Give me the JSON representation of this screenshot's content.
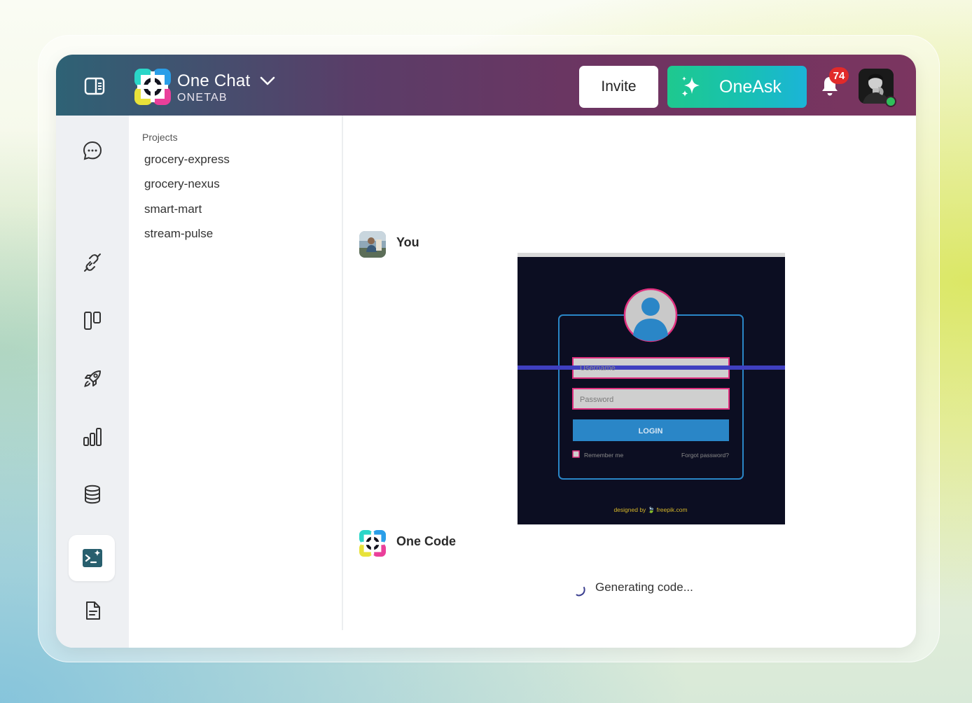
{
  "header": {
    "app_title": "One Chat",
    "app_subtitle": "ONETAB",
    "invite_label": "Invite",
    "oneask_label": "OneAsk",
    "notification_count": "74"
  },
  "projects": {
    "label": "Projects",
    "items": [
      "grocery-express",
      "grocery-nexus",
      "smart-mart",
      "stream-pulse"
    ]
  },
  "chat": {
    "user_name": "You",
    "bot_name": "One Code",
    "status_text": "Generating code..."
  },
  "attachment": {
    "username_placeholder": "Username",
    "password_placeholder": "Password",
    "login_label": "LOGIN",
    "remember_label": "Remember me",
    "forgot_label": "Forgot password?",
    "credit": "designed by 🍃 freepik.com"
  },
  "colors": {
    "accent_green": "#1ec98e",
    "accent_blue": "#1bb4d8",
    "header_start": "#2e6275",
    "header_end": "#7b3560",
    "badge_red": "#e12a2a",
    "login_blue": "#2a86c7",
    "field_pink": "#e0307f"
  },
  "icons": {
    "rail": [
      "chat-bubble-icon",
      "plug-icon",
      "columns-icon",
      "rocket-icon",
      "bar-chart-icon",
      "database-icon",
      "code-sparkle-icon",
      "document-icon",
      "gear-icon"
    ]
  }
}
